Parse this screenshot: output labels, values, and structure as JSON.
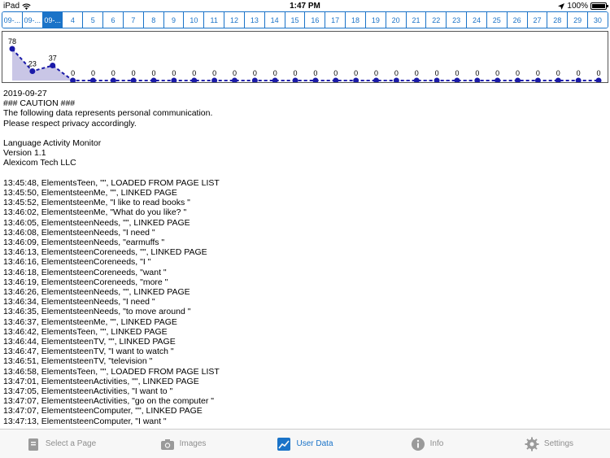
{
  "status_bar": {
    "device": "iPad",
    "time": "1:47 PM",
    "battery": "100%",
    "battery_level": 1.0
  },
  "date_tabs": [
    {
      "label": "09-...",
      "active": false
    },
    {
      "label": "09-...",
      "active": false
    },
    {
      "label": "09-...",
      "active": true
    },
    {
      "label": "4"
    },
    {
      "label": "5"
    },
    {
      "label": "6"
    },
    {
      "label": "7"
    },
    {
      "label": "8"
    },
    {
      "label": "9"
    },
    {
      "label": "10"
    },
    {
      "label": "11"
    },
    {
      "label": "12"
    },
    {
      "label": "13"
    },
    {
      "label": "14"
    },
    {
      "label": "15"
    },
    {
      "label": "16"
    },
    {
      "label": "17"
    },
    {
      "label": "18"
    },
    {
      "label": "19"
    },
    {
      "label": "20"
    },
    {
      "label": "21"
    },
    {
      "label": "22"
    },
    {
      "label": "23"
    },
    {
      "label": "24"
    },
    {
      "label": "25"
    },
    {
      "label": "26"
    },
    {
      "label": "27"
    },
    {
      "label": "28"
    },
    {
      "label": "29"
    },
    {
      "label": "30"
    }
  ],
  "chart_data": {
    "type": "area",
    "values": [
      78,
      23,
      37,
      0,
      0,
      0,
      0,
      0,
      0,
      0,
      0,
      0,
      0,
      0,
      0,
      0,
      0,
      0,
      0,
      0,
      0,
      0,
      0,
      0,
      0,
      0,
      0,
      0,
      0,
      0
    ],
    "ylim": [
      0,
      100
    ],
    "line_color": "#1a1aa8",
    "fill_color": "#c9c6e6",
    "grid": false
  },
  "log": {
    "header": [
      "2019-09-27",
      "### CAUTION ###",
      "The following data represents personal communication.",
      "Please respect privacy accordingly.",
      "",
      "Language Activity Monitor",
      "Version 1.1",
      "Alexicom Tech LLC",
      ""
    ],
    "entries": [
      "13:45:48, ElementsTeen, \"\", LOADED FROM PAGE LIST",
      "13:45:50, ElementsteenMe, \"\", LINKED PAGE",
      "13:45:52, ElementsteenMe, \"I like to read books \"",
      "13:46:02, ElementsteenMe, \"What do you like? \"",
      "13:46:05, ElementsteenNeeds, \"\", LINKED PAGE",
      "13:46:08, ElementsteenNeeds, \"I need \"",
      "13:46:09, ElementsteenNeeds, \"earmuffs \"",
      "13:46:13, ElementsteenCoreneeds, \"\", LINKED PAGE",
      "13:46:16, ElementsteenCoreneeds, \"I \"",
      "13:46:18, ElementsteenCoreneeds, \"want \"",
      "13:46:19, ElementsteenCoreneeds, \"more \"",
      "13:46:26, ElementsteenNeeds, \"\", LINKED PAGE",
      "13:46:34, ElementsteenNeeds, \"I need \"",
      "13:46:35, ElementsteenNeeds, \"to move around \"",
      "13:46:37, ElementsteenMe, \"\", LINKED PAGE",
      "13:46:42, ElementsTeen, \"\", LINKED PAGE",
      "13:46:44, ElementsteenTV, \"\", LINKED PAGE",
      "13:46:47, ElementsteenTV, \"I want to watch \"",
      "13:46:51, ElementsteenTV, \"television \"",
      "13:46:58, ElementsTeen, \"\", LOADED FROM PAGE LIST",
      "13:47:01, ElementsteenActivities, \"\", LINKED PAGE",
      "13:47:05, ElementsteenActivities, \"I want to \"",
      "13:47:07, ElementsteenActivities, \"go on the computer \"",
      "13:47:07, ElementsteenComputer, \"\", LINKED PAGE",
      "13:47:13, ElementsteenComputer, \"I want \""
    ]
  },
  "bottom_tabs": [
    {
      "label": "Select a Page",
      "icon": "page-icon",
      "active": false
    },
    {
      "label": "Images",
      "icon": "camera-icon",
      "active": false
    },
    {
      "label": "User Data",
      "icon": "chart-icon",
      "active": true
    },
    {
      "label": "Info",
      "icon": "info-icon",
      "active": false
    },
    {
      "label": "Settings",
      "icon": "gear-icon",
      "active": false
    }
  ],
  "colors": {
    "accent": "#1a73c8",
    "inactive": "#8e8e8e"
  }
}
